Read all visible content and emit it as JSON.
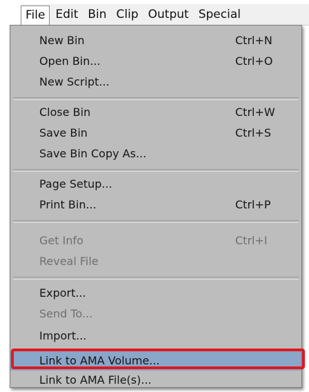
{
  "menubar": {
    "items": [
      "File",
      "Edit",
      "Bin",
      "Clip",
      "Output",
      "Special"
    ],
    "active": "File"
  },
  "file_menu": {
    "items": [
      {
        "label": "New Bin",
        "shortcut": "Ctrl+N"
      },
      {
        "label": "Open Bin...",
        "shortcut": "Ctrl+O"
      },
      {
        "label": "New Script...",
        "shortcut": ""
      },
      {
        "label": "Close Bin",
        "shortcut": "Ctrl+W"
      },
      {
        "label": "Save Bin",
        "shortcut": "Ctrl+S"
      },
      {
        "label": "Save Bin Copy As...",
        "shortcut": ""
      },
      {
        "label": "Page Setup...",
        "shortcut": ""
      },
      {
        "label": "Print Bin...",
        "shortcut": "Ctrl+P"
      },
      {
        "label": "Get Info",
        "shortcut": "Ctrl+I",
        "disabled": true
      },
      {
        "label": "Reveal File",
        "shortcut": "",
        "disabled": true
      },
      {
        "label": "Export...",
        "shortcut": ""
      },
      {
        "label": "Send To...",
        "shortcut": "",
        "disabled": true
      },
      {
        "label": "Import...",
        "shortcut": ""
      },
      {
        "label": "Link to AMA Volume...",
        "shortcut": "",
        "highlighted": true
      },
      {
        "label": "Link to AMA File(s)...",
        "shortcut": ""
      }
    ]
  },
  "colors": {
    "menu_background": "#bdbdbd",
    "highlight": "#8aa6c8",
    "callout": "#e0191e",
    "disabled_text": "#6f6f6f"
  }
}
